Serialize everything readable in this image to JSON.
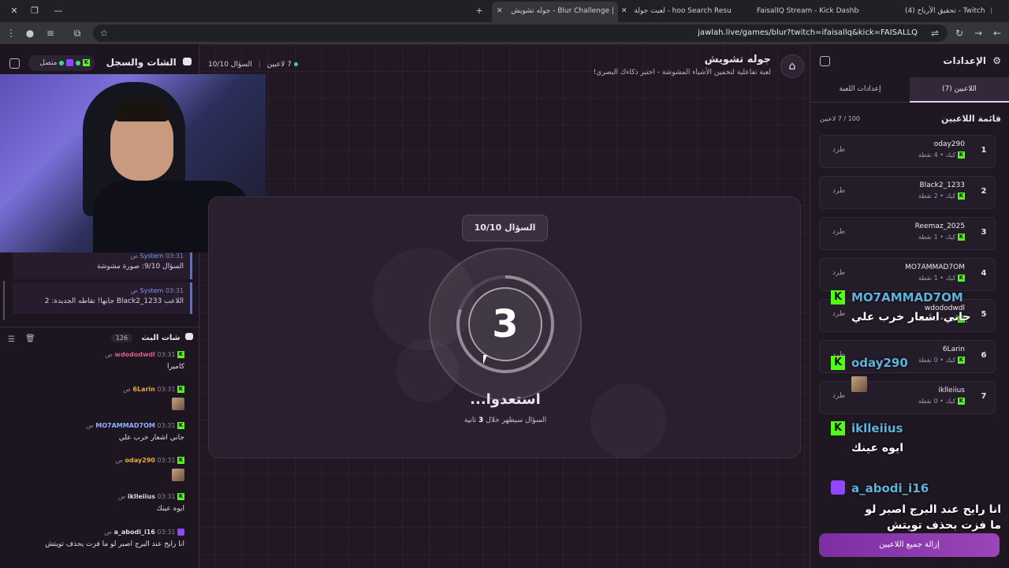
{
  "browser": {
    "tabs": [
      {
        "label": "(4) تحقيق الأرباح - Twitch"
      },
      {
        "label": "FaisalIQ Stream - Kick Dashboar"
      },
      {
        "label": "لعبت جولة - hoo Search Results"
      },
      {
        "label": "جوله تشويش - Blur Challenge |"
      }
    ],
    "url": "jawlah.live/games/blur?twitch=ifaisallq&kick=FAISALLQ"
  },
  "chat_panel": {
    "title": "الشات والسجل",
    "status": "متصل",
    "system_messages": [
      {
        "author": "System",
        "time": "03:31 ص",
        "text": "السؤال 9/10: صورة مشوشة"
      },
      {
        "author": "System",
        "time": "03:31 ص",
        "text": "اللاعب Black2_1233 جابها! نقاطه الجديدة: 2"
      }
    ],
    "stream_chat_title": "شات البث",
    "stream_chat_count": "126",
    "messages": [
      {
        "author": "wdododwdl",
        "time": "03:31 ص",
        "text": "كاميرا",
        "color": "#e05a83",
        "platform": "kick"
      },
      {
        "author": "6Larin",
        "time": "03:31 ص",
        "text": "",
        "color": "#e8a93b",
        "platform": "kick",
        "emote": true
      },
      {
        "author": "MO7AMMAD7OM",
        "time": "03:31 ص",
        "text": "جاني اشعار خرب علي",
        "color": "#8fb1ff",
        "platform": "kick"
      },
      {
        "author": "oday290",
        "time": "03:31 ص",
        "text": "",
        "color": "#e8a93b",
        "platform": "kick",
        "emote": true
      },
      {
        "author": "iklleiius",
        "time": "03:31 ص",
        "text": "ايوه عينك",
        "color": "#e0d3f0",
        "platform": "kick"
      },
      {
        "author": "a_abodi_i16",
        "time": "03:31 ص",
        "text": "انا رايح عند البرج اصبر لو ما فزت يحذف تويتش",
        "color": "#e0d3f0",
        "platform": "twitch"
      }
    ]
  },
  "game": {
    "title": "جوله تشويش",
    "subtitle": "لعبة تفاعلية لتخمين الأشياء المشوشة - اختبر ذكاءك البصري!",
    "question_progress": "السؤال 10/10",
    "players_online": "7 لاعبين",
    "question_badge": "السؤال 10/10",
    "countdown": "3",
    "countdown_fraction": 0.8,
    "ready_text": "استعدوا...",
    "ready_sub_before": "السؤال سيظهر خلال",
    "ready_sub_num": "3",
    "ready_sub_after": "ثانية"
  },
  "settings": {
    "title": "الإعدادات",
    "tab_players": "اللاعبين (7)",
    "tab_game_settings": "إعدادات اللعبة",
    "list_title": "قائمة اللاعبين",
    "list_count": "100 / 7 لاعبين",
    "kick_label": "طرد",
    "players": [
      {
        "rank": "1",
        "name": "oday290",
        "platform": "كيك",
        "points": "4 نقطة"
      },
      {
        "rank": "2",
        "name": "Black2_1233",
        "platform": "كيك",
        "points": "2 نقطة"
      },
      {
        "rank": "3",
        "name": "Reemaz_2025",
        "platform": "كيك",
        "points": "1 نقطة"
      },
      {
        "rank": "4",
        "name": "MO7AMMAD7OM",
        "platform": "كيك",
        "points": "1 نقطة"
      },
      {
        "rank": "5",
        "name": "wdododwdl",
        "platform": "كيك",
        "points": "0 نقطة"
      },
      {
        "rank": "6",
        "name": "6Larin",
        "platform": "كيك",
        "points": "0 نقطة"
      },
      {
        "rank": "7",
        "name": "iklleiius",
        "platform": "كيك",
        "points": "0 نقطة"
      }
    ],
    "remove_all": "إزالة جميع اللاعبين"
  },
  "overlay": {
    "items": [
      {
        "name": "MO7AMMAD7OM",
        "text": "جاني اشعار خرب علي",
        "platform": "kick"
      },
      {
        "name": "oday290",
        "text": "",
        "platform": "kick",
        "emote": true
      },
      {
        "name": "iklleiius",
        "text": "ايوه عينك",
        "platform": "kick"
      },
      {
        "name": "a_abodi_i16",
        "text": "انا رايح عند البرج اصبر لو ما فزت بحذف تويتش",
        "platform": "twitch"
      }
    ]
  },
  "colors": {
    "accent": "#8e3fb0",
    "kick": "#53fc18",
    "twitch": "#9146ff"
  }
}
